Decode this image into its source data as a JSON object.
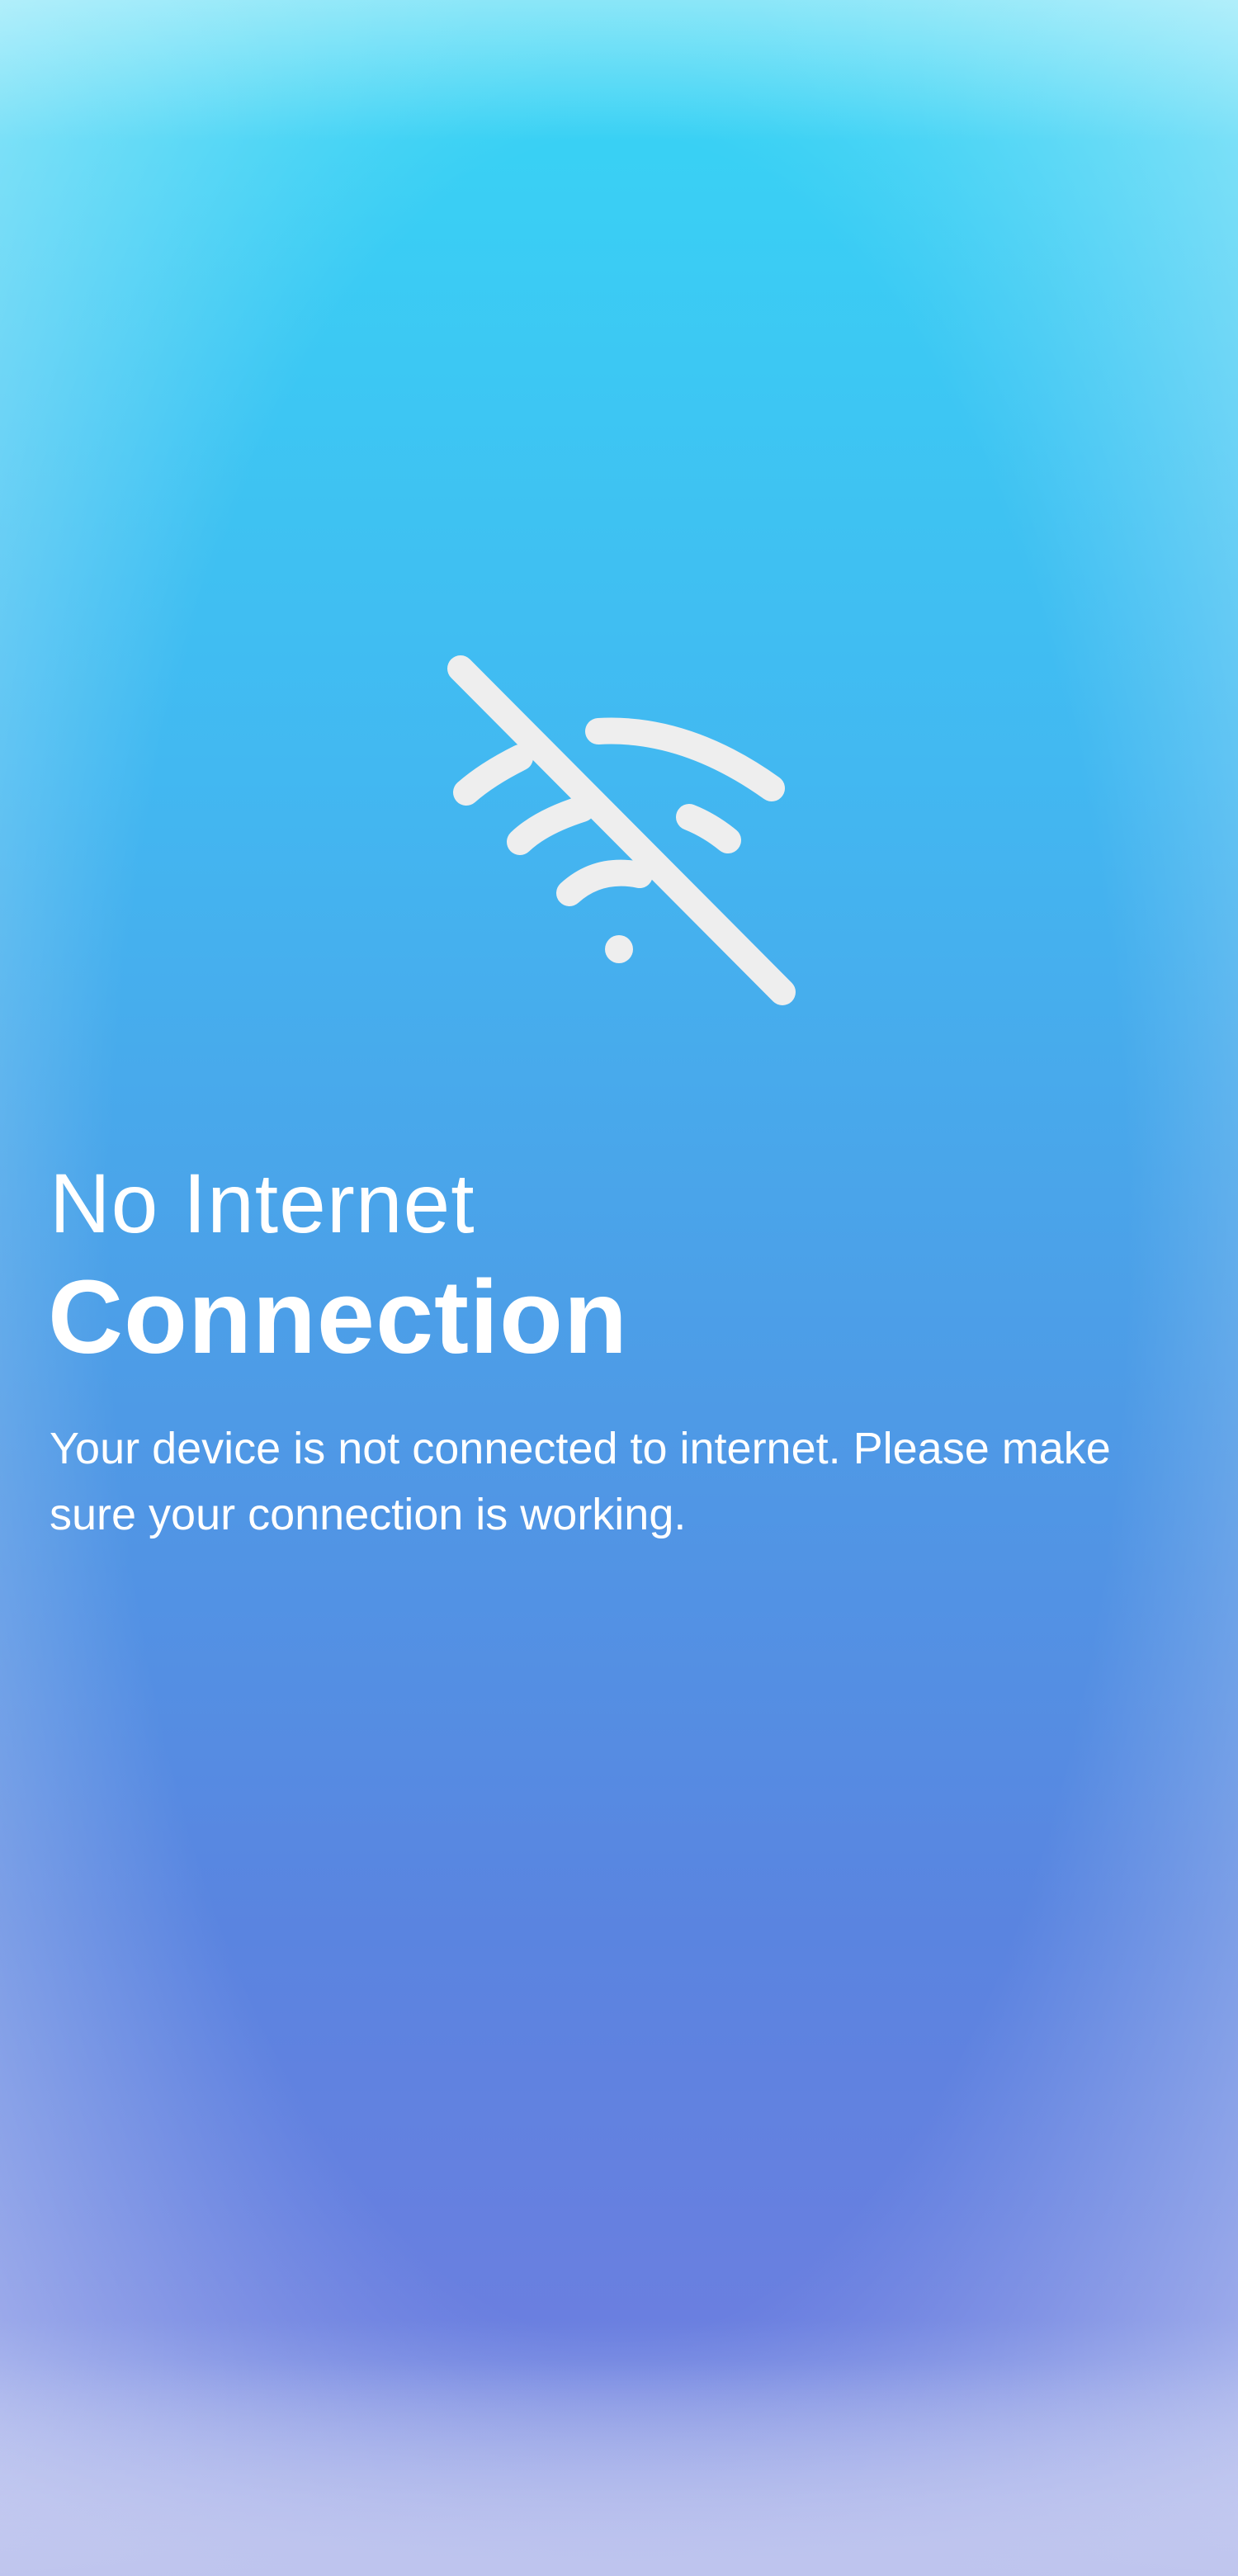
{
  "screen": {
    "icon": "wifi-off-icon",
    "title_line1": "No Internet",
    "title_line2": "Connection",
    "message": "Your device is not connected to internet. Please make sure your connection is working."
  },
  "colors": {
    "gradient_top": "#37d6f5",
    "gradient_mid": "#4e9ae6",
    "gradient_bottom": "#6a7fe0",
    "icon_color": "#eeeeee",
    "text_color": "#ffffff"
  }
}
